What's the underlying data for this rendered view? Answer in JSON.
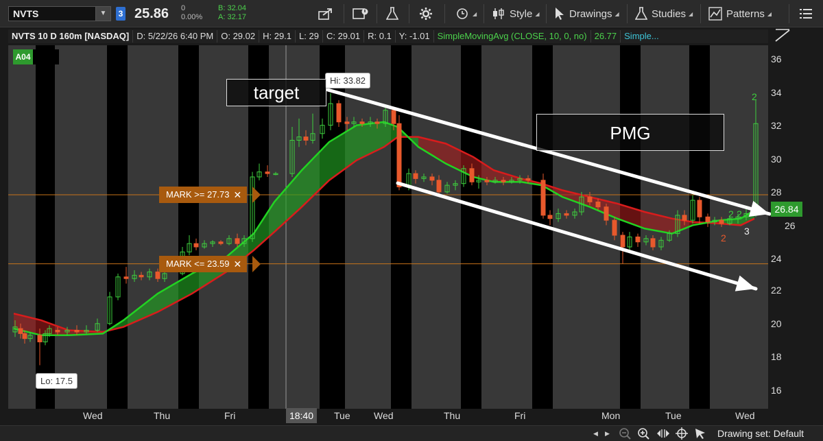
{
  "toolbar": {
    "symbol": "NVTS",
    "link_group": "3",
    "last": "25.86",
    "change": "0",
    "change_pct": "0.00%",
    "bid": "B: 32.04",
    "ask": "A: 32.17",
    "style_label": "Style",
    "drawings_label": "Drawings",
    "studies_label": "Studies",
    "patterns_label": "Patterns"
  },
  "infobar": {
    "title": "NVTS 10 D 160m [NASDAQ]",
    "date": "D: 5/22/26 6:40 PM",
    "open": "O: 29.02",
    "high": "H: 29.1",
    "low": "L: 29",
    "close": "C: 29.01",
    "range": "R: 0.1",
    "y": "Y: -1.01",
    "sma1": "SimpleMovingAvg (CLOSE, 10, 0, no)",
    "sma1_value": "26.77",
    "sma2": "Simple..."
  },
  "chart": {
    "study_tag": "A04",
    "price_marker": "26.84",
    "hi_label": "Hi: 33.82",
    "lo_label": "Lo: 17.5",
    "mark_upper": "MARK >= 27.73",
    "mark_lower": "MARK <= 23.59",
    "mark_close": "✕",
    "target_text": "target",
    "pmg_text": "PMG",
    "time_cursor": "18:40",
    "y_ticks": [
      "36",
      "34",
      "32",
      "30",
      "28",
      "26",
      "24",
      "22",
      "20",
      "18",
      "16"
    ],
    "x_days": [
      "Wed",
      "Thu",
      "Fri",
      "Tue",
      "Wed",
      "Thu",
      "Fri",
      "Mon",
      "Tue",
      "Wed"
    ],
    "count_labels": [
      "2",
      "2",
      "2",
      "3",
      "2"
    ],
    "colors": {
      "up": "#3ecf3e",
      "down": "#e8592c",
      "sma_fast": "#22d322",
      "sma_slow": "#d91c1c",
      "mark_line": "#c8731a"
    }
  },
  "bottombar": {
    "drawing_set": "Drawing set: Default"
  }
}
